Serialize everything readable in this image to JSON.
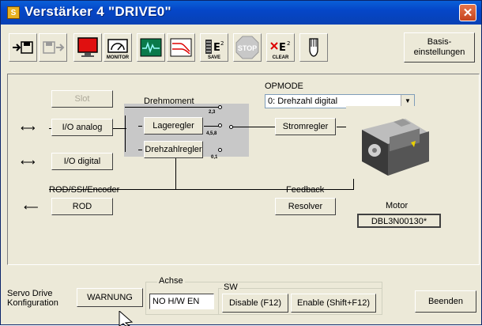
{
  "window": {
    "title": "Verstärker 4 \"DRIVE0\"",
    "icon_letter": "S",
    "close_glyph": "✕"
  },
  "toolbar": {
    "monitor_sub": "MONITOR",
    "save_sub": "SAVE",
    "stop_label": "STOP",
    "clear_sub": "CLEAR",
    "basis_line1": "Basis-",
    "basis_line2": "einstellungen"
  },
  "diagram": {
    "slot_label": "Slot",
    "drehmoment_label": "Drehmoment",
    "opmode_label": "OPMODE",
    "opmode_value": "0: Drehzahl digital",
    "io_analog_label": "I/O analog",
    "io_digital_label": "I/O digital",
    "lageregler_label": "Lageregler",
    "drehzahlregler_label": "Drehzahlregler",
    "stromregler_label": "Stromregler",
    "rod_ssi_label": "ROD/SSI/Encoder",
    "rod_button_label": "ROD",
    "feedback_label": "Feedback",
    "resolver_label": "Resolver",
    "motor_label": "Motor",
    "motor_value": "DBL3N00130*",
    "mode_23": "2,3",
    "mode_458": "4,5,8",
    "mode_01": "0,1"
  },
  "footer": {
    "servo_line1": "Servo Drive",
    "servo_line2": "Konfiguration",
    "warning_label": "WARNUNG",
    "achse_label": "Achse",
    "achse_value": "NO H/W EN",
    "sw_label": "SW",
    "disable_label": "Disable (F12)",
    "enable_label": "Enable (Shift+F12)",
    "beenden_label": "Beenden"
  }
}
